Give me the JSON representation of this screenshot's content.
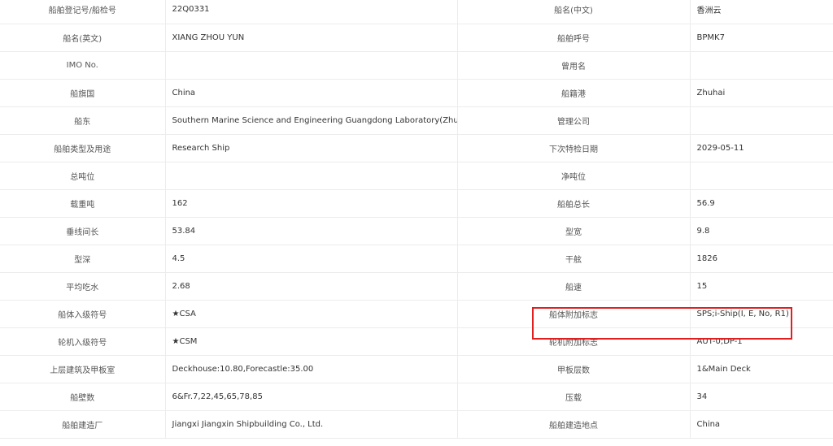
{
  "table": {
    "rows": [
      [
        "船舶登记号/船检号",
        "22Q0331",
        "船名(中文)",
        "香洲云"
      ],
      [
        "船名(英文)",
        "XIANG ZHOU YUN",
        "船舶呼号",
        "BPMK7"
      ],
      [
        "IMO No.",
        "",
        "曾用名",
        ""
      ],
      [
        "船旗国",
        "China",
        "船籍港",
        "Zhuhai"
      ],
      [
        "船东",
        "Southern Marine Science and Engineering Guangdong Laboratory(Zhuhai)",
        "管理公司",
        ""
      ],
      [
        "船舶类型及用途",
        "Research Ship",
        "下次特检日期",
        "2029-05-11"
      ],
      [
        "总吨位",
        "",
        "净吨位",
        ""
      ],
      [
        "载重吨",
        "162",
        "船舶总长",
        "56.9"
      ],
      [
        "垂线间长",
        "53.84",
        "型宽",
        "9.8"
      ],
      [
        "型深",
        "4.5",
        "干舷",
        "1826"
      ],
      [
        "平均吃水",
        "2.68",
        "船速",
        "15"
      ],
      [
        "船体入级符号",
        "★CSA",
        "船体附加标志",
        "SPS;i-Ship(I, E, No, R1)"
      ],
      [
        "轮机入级符号",
        "★CSM",
        "轮机附加标志",
        "AUT-0;DP-1"
      ],
      [
        "上层建筑及甲板室",
        "Deckhouse:10.80,Forecastle:35.00",
        "甲板层数",
        "1&Main Deck"
      ],
      [
        "船壁数",
        "6&Fr.7,22,45,65,78,85",
        "压载",
        "34"
      ],
      [
        "船舶建造厂",
        "Jiangxi Jiangxin Shipbuilding Co., Ltd.",
        "船舶建造地点",
        "China"
      ]
    ]
  },
  "highlight": {
    "row": 11,
    "color": "#e02020"
  }
}
